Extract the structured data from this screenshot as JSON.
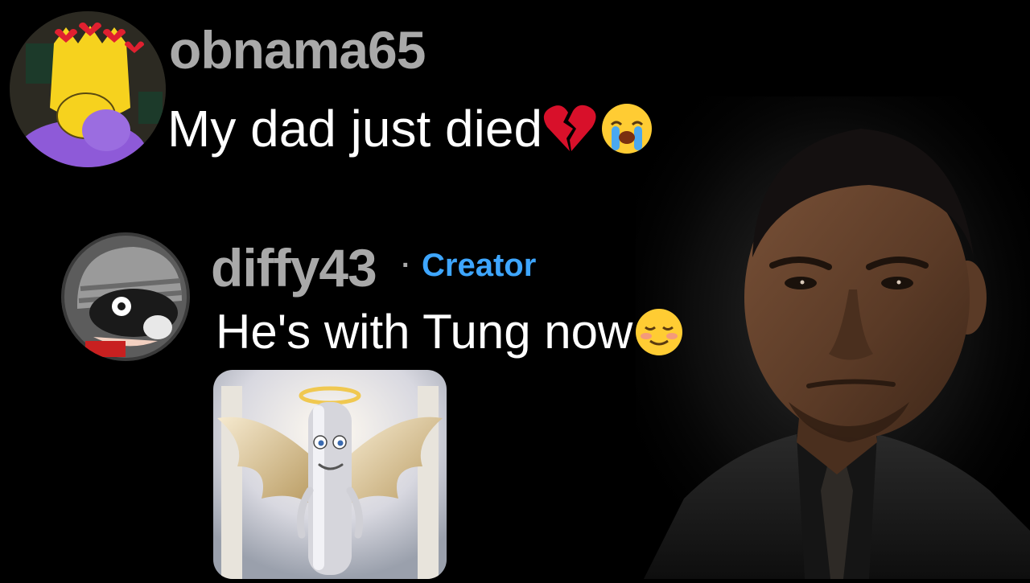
{
  "comments": [
    {
      "username": "obnama65",
      "text": "My dad just died",
      "emojis": [
        "broken-heart-icon",
        "loudly-crying-face-icon"
      ]
    },
    {
      "username": "diffy43",
      "separator": "·",
      "badge": "Creator",
      "text": "He's with Tung now",
      "emojis": [
        "smiling-face-icon"
      ]
    }
  ],
  "colors": {
    "background": "#000000",
    "username": "#a9a9a9",
    "creator_badge": "#3ea6ff",
    "message": "#ffffff"
  }
}
